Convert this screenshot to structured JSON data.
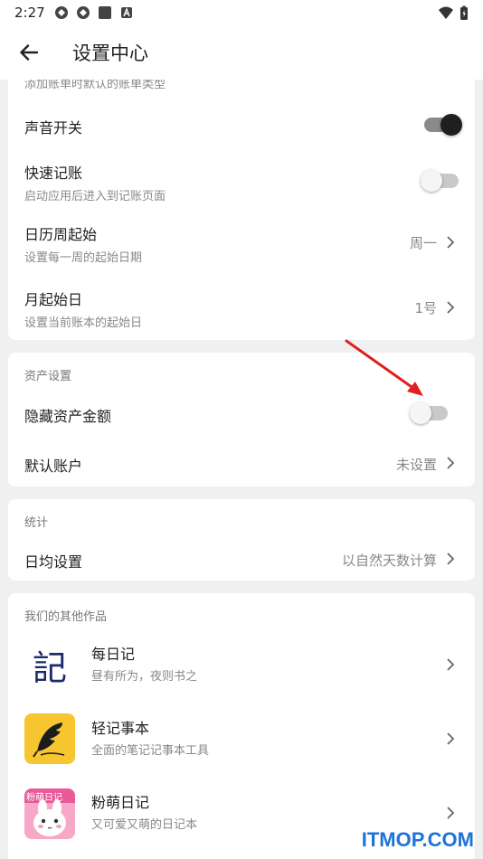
{
  "status_bar": {
    "time": "2:27"
  },
  "header": {
    "title": "设置中心"
  },
  "card1": {
    "partial_caption": "添加账单时默认的账单类型",
    "sound": {
      "label": "声音开关",
      "enabled": true
    },
    "quick": {
      "label": "快速记账",
      "desc": "启动应用后进入到记账页面",
      "enabled": false
    },
    "week_start": {
      "label": "日历周起始",
      "desc": "设置每一周的起始日期",
      "value": "周一"
    },
    "month_start": {
      "label": "月起始日",
      "desc": "设置当前账本的起始日",
      "value": "1号"
    }
  },
  "assets": {
    "title": "资产设置",
    "hide_amount": {
      "label": "隐藏资产金额",
      "enabled": false
    },
    "default_account": {
      "label": "默认账户",
      "value": "未设置"
    }
  },
  "stats": {
    "title": "统计",
    "daily_avg": {
      "label": "日均设置",
      "value": "以自然天数计算"
    }
  },
  "other_apps": {
    "title": "我们的其他作品",
    "items": [
      {
        "name": "每日记",
        "desc": "昼有所为，夜则书之",
        "icon": "meiriji-app-icon",
        "icon_text": "記"
      },
      {
        "name": "轻记事本",
        "desc": "全面的笔记记事本工具",
        "icon": "feather-notebook-app-icon"
      },
      {
        "name": "粉萌日记",
        "desc": "又可爱又萌的日记本",
        "icon": "cute-bunny-diary-app-icon",
        "icon_text": "粉萌日记"
      }
    ]
  },
  "watermark": "ITMOP.COM",
  "colors": {
    "accent_arrow": "#e02020",
    "watermark": "#1e73d8"
  }
}
